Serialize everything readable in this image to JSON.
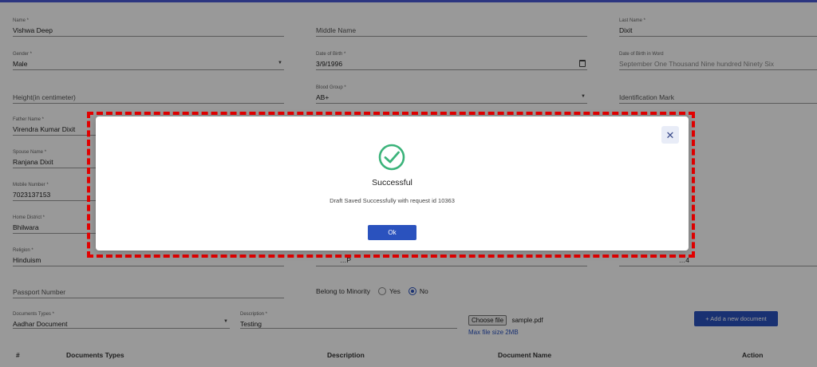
{
  "fields": {
    "name": {
      "label": "Name *",
      "value": "Vishwa Deep"
    },
    "middle_name": {
      "label": "",
      "value": "Middle Name"
    },
    "last_name": {
      "label": "Last Name *",
      "value": "Dixit"
    },
    "gender": {
      "label": "Gender *",
      "value": "Male"
    },
    "dob": {
      "label": "Date of Birth *",
      "value": "3/9/1996"
    },
    "dob_words": {
      "label": "Date of Birth in Word",
      "value": "September One Thousand Nine hundred Ninety Six"
    },
    "height": {
      "label": "",
      "value": "Height(in centimeter)"
    },
    "blood_group": {
      "label": "Blood Group *",
      "value": "AB+"
    },
    "identification_mark": {
      "label": "",
      "value": "Identification Mark"
    },
    "father_name": {
      "label": "Father Name *",
      "value": "Virendra Kumar Dixit"
    },
    "spouse_name": {
      "label": "Spouse Name *",
      "value": "Ranjana Dixit"
    },
    "mobile": {
      "label": "Mobile Number *",
      "value": "7023137153"
    },
    "home_district": {
      "label": "Home District *",
      "value": "Bhilwara"
    },
    "religion": {
      "label": "Religion *",
      "value": "Hinduism"
    },
    "pan_partial": {
      "value": "…P"
    },
    "aadhaar_partial": {
      "value": "…4"
    },
    "passport": {
      "label": "",
      "value": "Passport Number"
    },
    "document_type": {
      "label": "Documents Types *",
      "value": "Aadhar Document"
    },
    "description": {
      "label": "Description *",
      "value": "Testing"
    }
  },
  "minority": {
    "label": "Belong to Minority",
    "yes": "Yes",
    "no": "No",
    "selected": "No"
  },
  "file": {
    "button": "Choose file",
    "name": "sample.pdf",
    "hint": "Max file size 2MB"
  },
  "add_document_button": "+ Add a new document",
  "table_headers": [
    "#",
    "Documents Types",
    "Description",
    "Document Name",
    "Action"
  ],
  "modal": {
    "title": "Successful",
    "message": "Draft Saved Successfully with request id 10363",
    "ok": "Ok",
    "close": "✕"
  },
  "colors": {
    "primary": "#2a52be",
    "success": "#3bb37a",
    "highlight": "#e30000"
  }
}
